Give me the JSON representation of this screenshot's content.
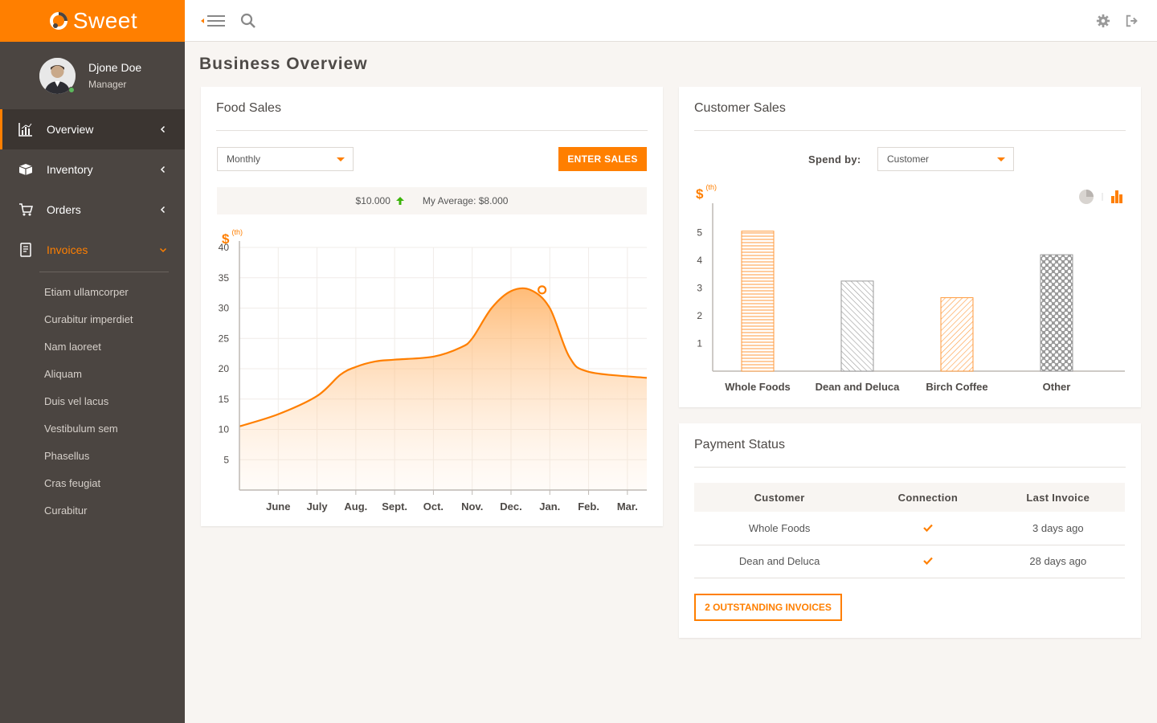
{
  "app": {
    "name": "Sweet",
    "accent": "#ff7f00",
    "sidebar_bg": "#4b4541"
  },
  "user": {
    "name": "Djone Doe",
    "role": "Manager",
    "status": "online"
  },
  "nav": {
    "items": [
      {
        "label": "Overview",
        "icon": "bar-chart-icon",
        "state": "active"
      },
      {
        "label": "Inventory",
        "icon": "truck-icon",
        "state": "collapsed"
      },
      {
        "label": "Orders",
        "icon": "cart-icon",
        "state": "collapsed"
      },
      {
        "label": "Invoices",
        "icon": "invoice-icon",
        "state": "open"
      }
    ],
    "invoices_sub": [
      "Etiam ullamcorper",
      "Curabitur imperdiet",
      "Nam laoreet",
      "Aliquam",
      "Duis vel lacus",
      "Vestibulum sem",
      "Phasellus",
      "Cras feugiat",
      "Curabitur"
    ]
  },
  "topbar": {
    "icons": [
      "menu-toggle-icon",
      "search-icon",
      "gear-icon",
      "logout-icon"
    ]
  },
  "page": {
    "title": "Business Overview"
  },
  "food_sales": {
    "title": "Food Sales",
    "period_select": "Monthly",
    "enter_button": "ENTER SALES",
    "current_value": "$10.000",
    "trend": "up",
    "average": "My Average: $8.000",
    "unit_symbol": "$",
    "unit_suffix": "(th)"
  },
  "customer_sales": {
    "title": "Customer Sales",
    "spend_by_label": "Spend by:",
    "spend_by_select": "Customer",
    "unit_symbol": "$",
    "unit_suffix": "(th)",
    "view_icons": [
      "pie-chart-icon",
      "bar-chart-icon"
    ]
  },
  "payment_status": {
    "title": "Payment Status",
    "columns": [
      "Customer",
      "Connection",
      "Last Invoice"
    ],
    "rows": [
      {
        "customer": "Whole Foods",
        "connected": true,
        "last_invoice": "3 days ago"
      },
      {
        "customer": "Dean and Deluca",
        "connected": true,
        "last_invoice": "28 days ago"
      }
    ],
    "outstanding_button": "2 OUTSTANDING INVOICES"
  },
  "chart_data": [
    {
      "type": "area",
      "categories": [
        "June",
        "July",
        "Aug.",
        "Sept.",
        "Oct.",
        "Nov.",
        "Dec.",
        "Jan.",
        "Feb.",
        "Mar."
      ],
      "x_domain": [
        0,
        10.5
      ],
      "x": [
        0,
        1,
        2,
        2.6,
        3,
        3.5,
        4,
        5,
        5.7,
        6,
        6.5,
        7,
        7.5,
        8,
        8.5,
        9,
        10.5
      ],
      "y": [
        10.5,
        12.5,
        15.5,
        19,
        20.3,
        21.2,
        21.5,
        22,
        23.5,
        25,
        30,
        32.8,
        33,
        30,
        22,
        19.5,
        18.5
      ],
      "highlight": {
        "x": 7.8,
        "y": 33
      },
      "ylim": [
        0,
        40
      ],
      "yticks": [
        5,
        10,
        15,
        20,
        25,
        30,
        35,
        40
      ],
      "grid": true
    },
    {
      "type": "bar",
      "categories": [
        "Whole Foods",
        "Dean and Deluca",
        "Birch Coffee",
        "Other"
      ],
      "values": [
        5.05,
        3.25,
        2.65,
        4.2
      ],
      "patterns": [
        "horizontal-lines",
        "diagonal-lines-gray",
        "diagonal-lines-orange",
        "dots"
      ],
      "ylim": [
        0,
        6
      ],
      "yticks": [
        1,
        2,
        3,
        4,
        5
      ],
      "grid": false
    }
  ]
}
